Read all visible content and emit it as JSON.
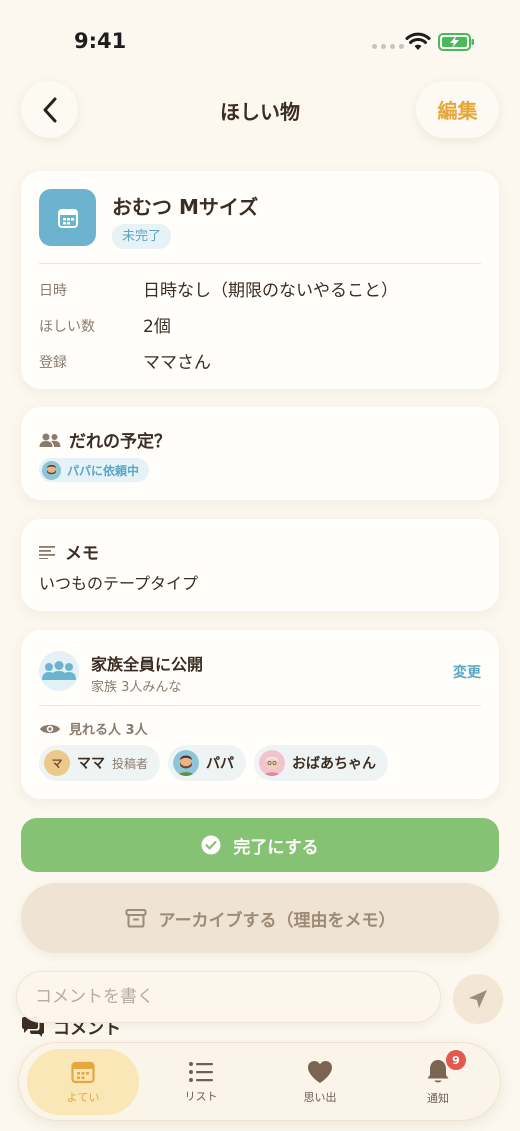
{
  "status_bar": {
    "time": "9:41"
  },
  "nav": {
    "title": "ほしい物",
    "edit_label": "編集"
  },
  "item": {
    "title": "おむつ Mサイズ",
    "status": "未完了",
    "rows": [
      {
        "label": "日時",
        "value": "日時なし（期限のないやること）"
      },
      {
        "label": "ほしい数",
        "value": "2個"
      },
      {
        "label": "登録",
        "value": "ママさん"
      }
    ]
  },
  "assignment": {
    "heading": "だれの予定？",
    "request_chip": "パパに依頼中"
  },
  "memo": {
    "heading": "メモ",
    "text": "いつものテープタイプ"
  },
  "visibility": {
    "title": "家族全員に公開",
    "subtitle": "家族 3人みんな",
    "change_label": "変更",
    "viewers_label": "見れる人 3人",
    "members": [
      {
        "name": "ママ",
        "initial": "マ",
        "role": "投稿者"
      },
      {
        "name": "パパ"
      },
      {
        "name": "おばあちゃん"
      }
    ]
  },
  "actions": {
    "complete_label": "完了にする",
    "archive_label": "アーカイブする（理由をメモ）"
  },
  "comments": {
    "heading": "コメント",
    "input_placeholder": "コメントを書く"
  },
  "tabbar": {
    "tabs": [
      {
        "label": "よてい",
        "icon": "calendar-icon",
        "active": true
      },
      {
        "label": "リスト",
        "icon": "list-icon"
      },
      {
        "label": "思い出",
        "icon": "heart-icon"
      },
      {
        "label": "通知",
        "icon": "bell-icon",
        "badge": "9"
      }
    ]
  },
  "colors": {
    "accent": "#e6a73c",
    "complete": "#86c273",
    "info": "#5aa6c6",
    "badge": "#e05a4f"
  }
}
